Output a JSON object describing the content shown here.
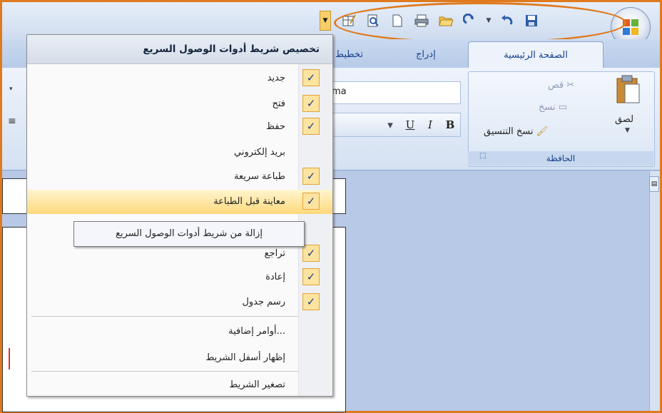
{
  "window": {
    "tabs": {
      "home": "الصفحة الرئيسية",
      "insert": "إدراج",
      "layout": "تخطيط"
    },
    "clipboard": {
      "cut": "قص",
      "copy": "نسخ",
      "format_painter": "نسخ التنسيق",
      "paste": "لصق",
      "group_label": "الحافظة"
    },
    "font": {
      "name_value": "ma",
      "bold": "B",
      "italic": "I",
      "underline": "U"
    }
  },
  "qat_menu": {
    "title": "تخصيص شريط أدوات الوصول السريع",
    "items": [
      {
        "label": "جديد",
        "checked": true
      },
      {
        "label": "فتح",
        "checked": true
      },
      {
        "label": "حفظ",
        "checked": true
      },
      {
        "label": "بريد إلكتروني",
        "checked": false
      },
      {
        "label": "طباعة سريعة",
        "checked": true
      },
      {
        "label": "معاينة قبل الطباعة",
        "checked": true,
        "highlighted": true
      },
      {
        "label": "",
        "checked": false
      },
      {
        "label": "تراجع",
        "checked": true
      },
      {
        "label": "إعادة",
        "checked": true
      },
      {
        "label": "رسم جدول",
        "checked": true
      }
    ],
    "more_commands": "أوامر إضافية...",
    "show_below": "إظهار أسفل الشريط",
    "minimize": "تصغير الشريط",
    "check_mark": "✓"
  },
  "tooltip": "إزالة من شريط أدوات الوصول السريع",
  "icons": [
    "office-button-icon",
    "save-icon",
    "undo-icon",
    "redo-icon",
    "open-folder-icon",
    "print-icon",
    "new-document-icon",
    "print-preview-icon",
    "draw-table-icon",
    "customize-dropdown-icon"
  ],
  "colors": {
    "highlight_border": "#e07a1f",
    "check_bg": "#fde3a0",
    "ribbon_blue": "#15428b"
  }
}
